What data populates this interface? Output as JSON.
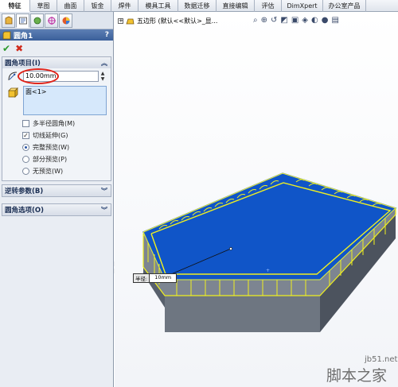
{
  "tabs": [
    "特征",
    "草图",
    "曲面",
    "钣金",
    "焊件",
    "模具工具",
    "数据迁移",
    "直接编辑",
    "评估",
    "DimXpert",
    "办公室产品"
  ],
  "property_manager": {
    "title": "圆角1",
    "help": "?",
    "items_group": {
      "header": "圆角项目(I)",
      "radius_value": "10.00mm",
      "selected_faces": [
        "面<1>"
      ],
      "options": [
        {
          "label": "多半径圆角(M)",
          "type": "checkbox",
          "checked": false
        },
        {
          "label": "切线延伸(G)",
          "type": "checkbox",
          "checked": true
        },
        {
          "label": "完整预览(W)",
          "type": "radio",
          "checked": true
        },
        {
          "label": "部分预览(P)",
          "type": "radio",
          "checked": false
        },
        {
          "label": "无预览(W)",
          "type": "radio",
          "checked": false
        }
      ]
    },
    "reverse_group": {
      "header": "逆转参数(B)"
    },
    "fillet_options_group": {
      "header": "圆角选项(O)"
    }
  },
  "feature_tree": {
    "text": "五边形 (默认<<默认>_显..."
  },
  "canvas": {
    "callout_label": "半径:",
    "callout_value": "10mm"
  },
  "watermark": {
    "url": "jb51.net",
    "name": "脚本之家"
  },
  "colors": {
    "face_blue": "#1055c8",
    "side_gray": "#58606c",
    "highlight": "#f0f020",
    "edge_blue": "#2d6cf0"
  }
}
